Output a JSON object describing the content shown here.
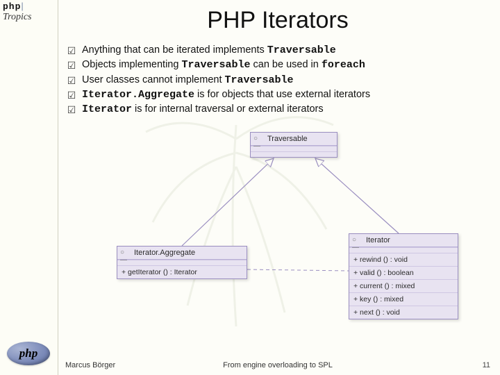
{
  "brand": {
    "top1": "php",
    "top2": "Tropics",
    "ellipse": "php"
  },
  "title": "PHP Iterators",
  "bullets": [
    {
      "pre": "Anything that can be iterated implements ",
      "kw1": "Traversable",
      "mid": "",
      "kw2": "",
      "post": ""
    },
    {
      "pre": "Objects implementing ",
      "kw1": "Traversable",
      "mid": " can be used in ",
      "kw2": "foreach",
      "post": ""
    },
    {
      "pre": "User classes cannot implement ",
      "kw1": "Traversable",
      "mid": "",
      "kw2": "",
      "post": ""
    },
    {
      "pre": "",
      "kw1": "Iterator.Aggregate",
      "mid": " is for objects that use external iterators",
      "kw2": "",
      "post": ""
    },
    {
      "pre": "",
      "kw1": "Iterator",
      "mid": " is for internal traversal or external iterators",
      "kw2": "",
      "post": ""
    }
  ],
  "uml": {
    "traversable": {
      "name": "Traversable",
      "stereo": "○—"
    },
    "aggregate": {
      "name": "Iterator.Aggregate",
      "stereo": "○—",
      "op": "+   getIterator ()   :  Iterator"
    },
    "iterator": {
      "name": "Iterator",
      "stereo": "○—",
      "ops": [
        "+   rewind ()   :  void",
        "+   valid ()      :  boolean",
        "+   current ()  :  mixed",
        "+   key ()        :  mixed",
        "+   next ()       :  void"
      ]
    }
  },
  "footer": {
    "author": "Marcus Börger",
    "talk": "From engine overloading to SPL",
    "page": "11"
  }
}
